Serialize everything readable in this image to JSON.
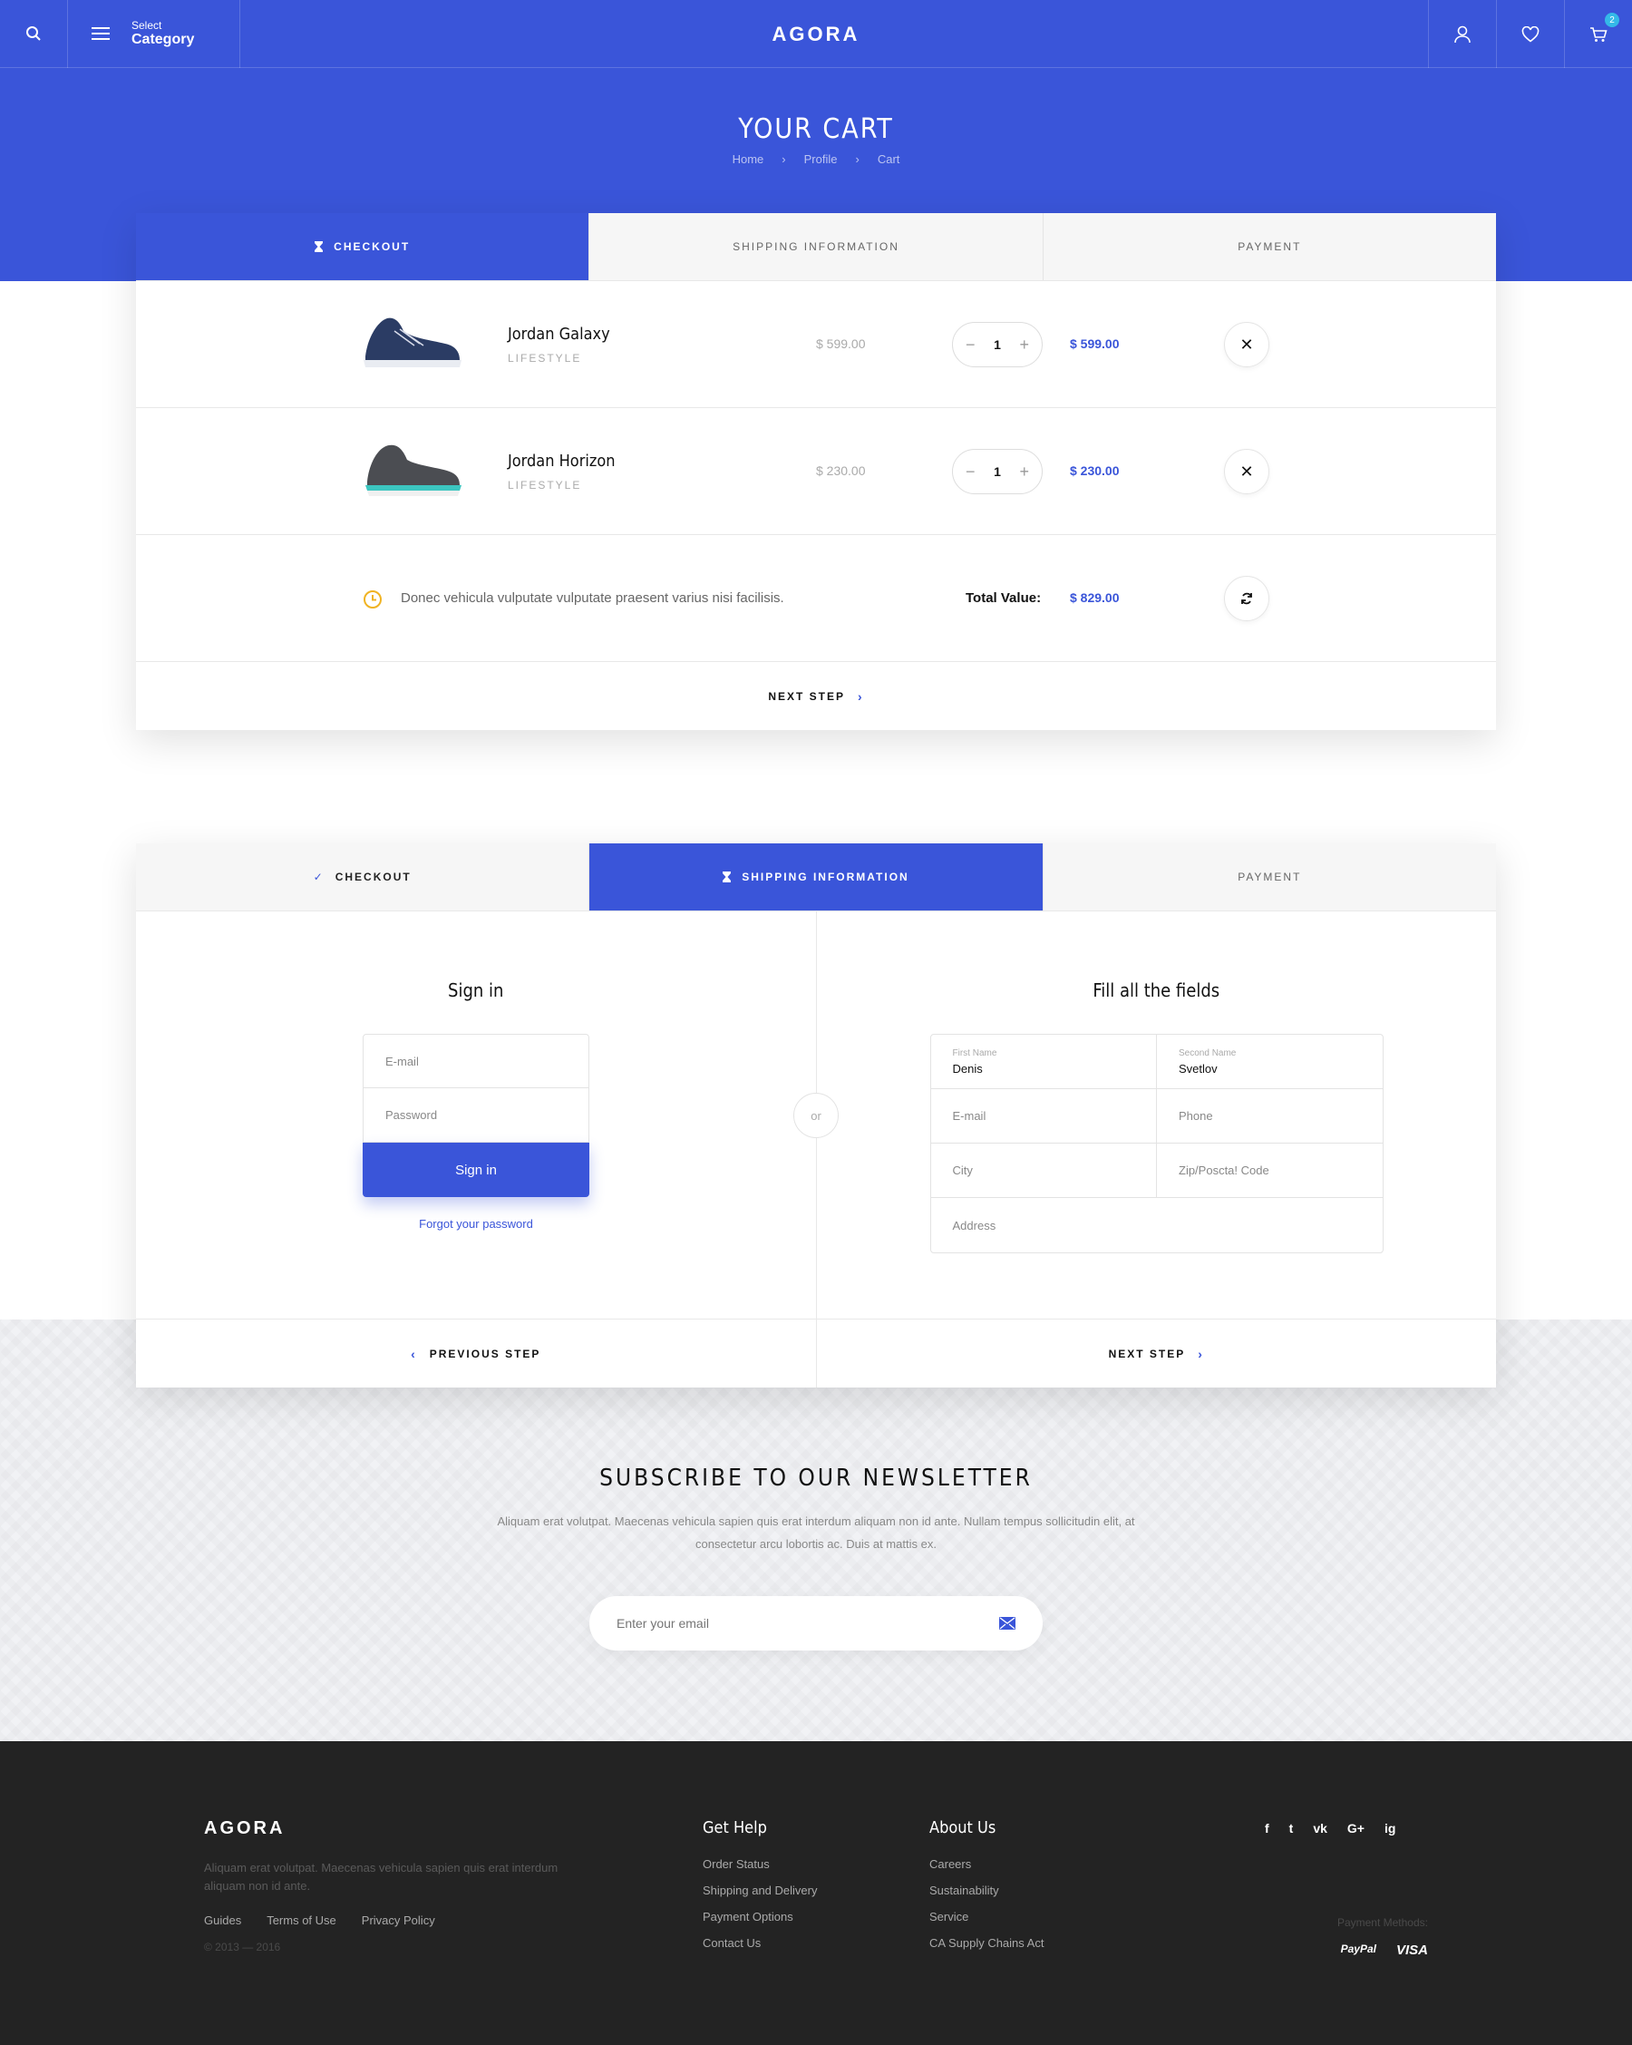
{
  "header": {
    "logo": "AGORA",
    "category_small": "Select",
    "category_big": "Category",
    "cart_count": "2"
  },
  "hero": {
    "title": "YOUR CART",
    "breadcrumb": [
      "Home",
      "Profile",
      "Cart"
    ],
    "breadcrumb_sep": "›"
  },
  "steps": {
    "checkout": "CHECKOUT",
    "shipping": "SHIPPING INFORMATION",
    "payment": "PAYMENT"
  },
  "cart": {
    "items": [
      {
        "name": "Jordan Galaxy",
        "category": "LIFESTYLE",
        "price": "$ 599.00",
        "qty": "1",
        "total": "$ 599.00",
        "color": "#2b3c64"
      },
      {
        "name": "Jordan Horizon",
        "category": "LIFESTYLE",
        "price": "$ 230.00",
        "qty": "1",
        "total": "$ 230.00",
        "color": "#4b4d52"
      }
    ],
    "note": "Donec vehicula vulputate vulputate praesent varius nisi facilisis.",
    "total_label": "Total Value:",
    "total_value": "$ 829.00",
    "next": "NEXT STEP"
  },
  "shipping": {
    "signin_title": "Sign in",
    "email_placeholder": "E-mail",
    "password_placeholder": "Password",
    "signin_button": "Sign in",
    "forgot": "Forgot your password",
    "or": "or",
    "fill_title": "Fill all the fields",
    "first_name_label": "First Name",
    "first_name": "Denis",
    "second_name_label": "Second Name",
    "second_name": "Svetlov",
    "email": "E-mail",
    "phone": "Phone",
    "city": "City",
    "zip": "Zip/Poscta! Code",
    "address": "Address",
    "prev": "PREVIOUS STEP",
    "next": "NEXT STEP"
  },
  "newsletter": {
    "title": "SUBSCRIBE TO OUR NEWSLETTER",
    "text": "Aliquam erat volutpat. Maecenas vehicula sapien quis erat interdum aliquam non id ante. Nullam tempus sollicitudin elit, at consectetur arcu lobortis ac. Duis at mattis ex.",
    "placeholder": "Enter your email"
  },
  "footer": {
    "logo": "AGORA",
    "desc": "Aliquam erat volutpat. Maecenas vehicula sapien quis erat interdum aliquam non id ante.",
    "links": [
      "Guides",
      "Terms of Use",
      "Privacy Policy"
    ],
    "copy": "© 2013 — 2016",
    "help_title": "Get Help",
    "help_items": [
      "Order Status",
      "Shipping and Delivery",
      "Payment Options",
      "Contact Us"
    ],
    "about_title": "About Us",
    "about_items": [
      "Careers",
      "Sustainability",
      "Service",
      "CA Supply Chains Act"
    ],
    "social": [
      "f",
      "t",
      "vk",
      "G+",
      "ig"
    ],
    "pay_label": "Payment Methods:",
    "pay_paypal": "PayPal",
    "pay_visa": "VISA"
  },
  "colors": {
    "accent": "#3a55d9",
    "footer_bg": "#232323",
    "clock": "#f0b323"
  }
}
